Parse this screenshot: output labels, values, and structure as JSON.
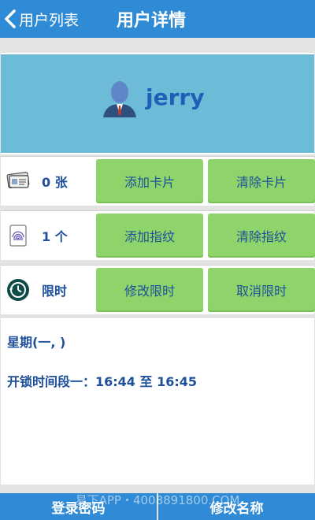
{
  "header": {
    "back_label": "用户列表",
    "title": "用户详情"
  },
  "profile": {
    "username": "jerry"
  },
  "cards": {
    "count_label": "0 张",
    "add_label": "添加卡片",
    "clear_label": "清除卡片"
  },
  "fingerprints": {
    "count_label": "1 个",
    "add_label": "添加指纹",
    "clear_label": "清除指纹"
  },
  "time_limit": {
    "label": "限时",
    "modify_label": "修改限时",
    "cancel_label": "取消限时"
  },
  "schedule": {
    "weekdays": "星期(一, )",
    "unlock_period": "开锁时间段一：16:44 至 16:45"
  },
  "footer": {
    "login_password_label": "登录密码",
    "rename_label": "修改名称",
    "watermark": "易下APP・4008891800.COM"
  },
  "colors": {
    "header_bg": "#2f8bd6",
    "profile_bg": "#6cbcd8",
    "button_bg": "#8fd46b",
    "text_blue": "#1e4f9a"
  }
}
